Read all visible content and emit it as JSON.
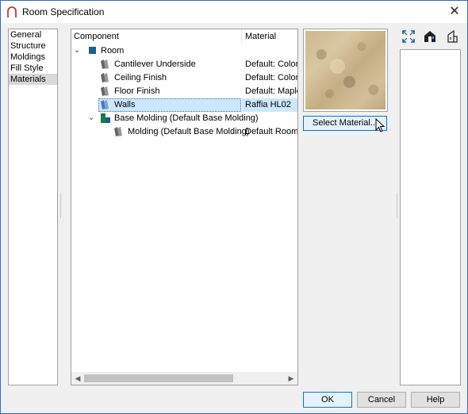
{
  "window": {
    "title": "Room Specification"
  },
  "nav": {
    "items": [
      "General",
      "Structure",
      "Moldings",
      "Fill Style",
      "Materials"
    ],
    "selected_index": 4
  },
  "tree": {
    "columns": {
      "component": "Component",
      "material": "Material"
    },
    "rows": [
      {
        "name": "Room",
        "material": ""
      },
      {
        "name": "Cantilever Underside",
        "material": "Default: Color -"
      },
      {
        "name": "Ceiling Finish",
        "material": "Default: Color -"
      },
      {
        "name": "Floor Finish",
        "material": "Default: Maple"
      },
      {
        "name": "Walls",
        "material": "Raffia HL02"
      },
      {
        "name": "Base Molding (Default Base Molding)",
        "material": ""
      },
      {
        "name": "Molding (Default Base Molding)",
        "material": "Default Room M"
      }
    ]
  },
  "buttons": {
    "select_material": "Select Material...",
    "ok": "OK",
    "cancel": "Cancel",
    "help": "Help"
  },
  "colors": {
    "accent": "#0078d7",
    "selection": "#cce8ff",
    "room_icon": "#1a5e8a"
  },
  "icons": {
    "close": "close-icon",
    "expand": "fullscreen-icon",
    "house": "house-view-icon",
    "elevation": "elevation-icon"
  }
}
